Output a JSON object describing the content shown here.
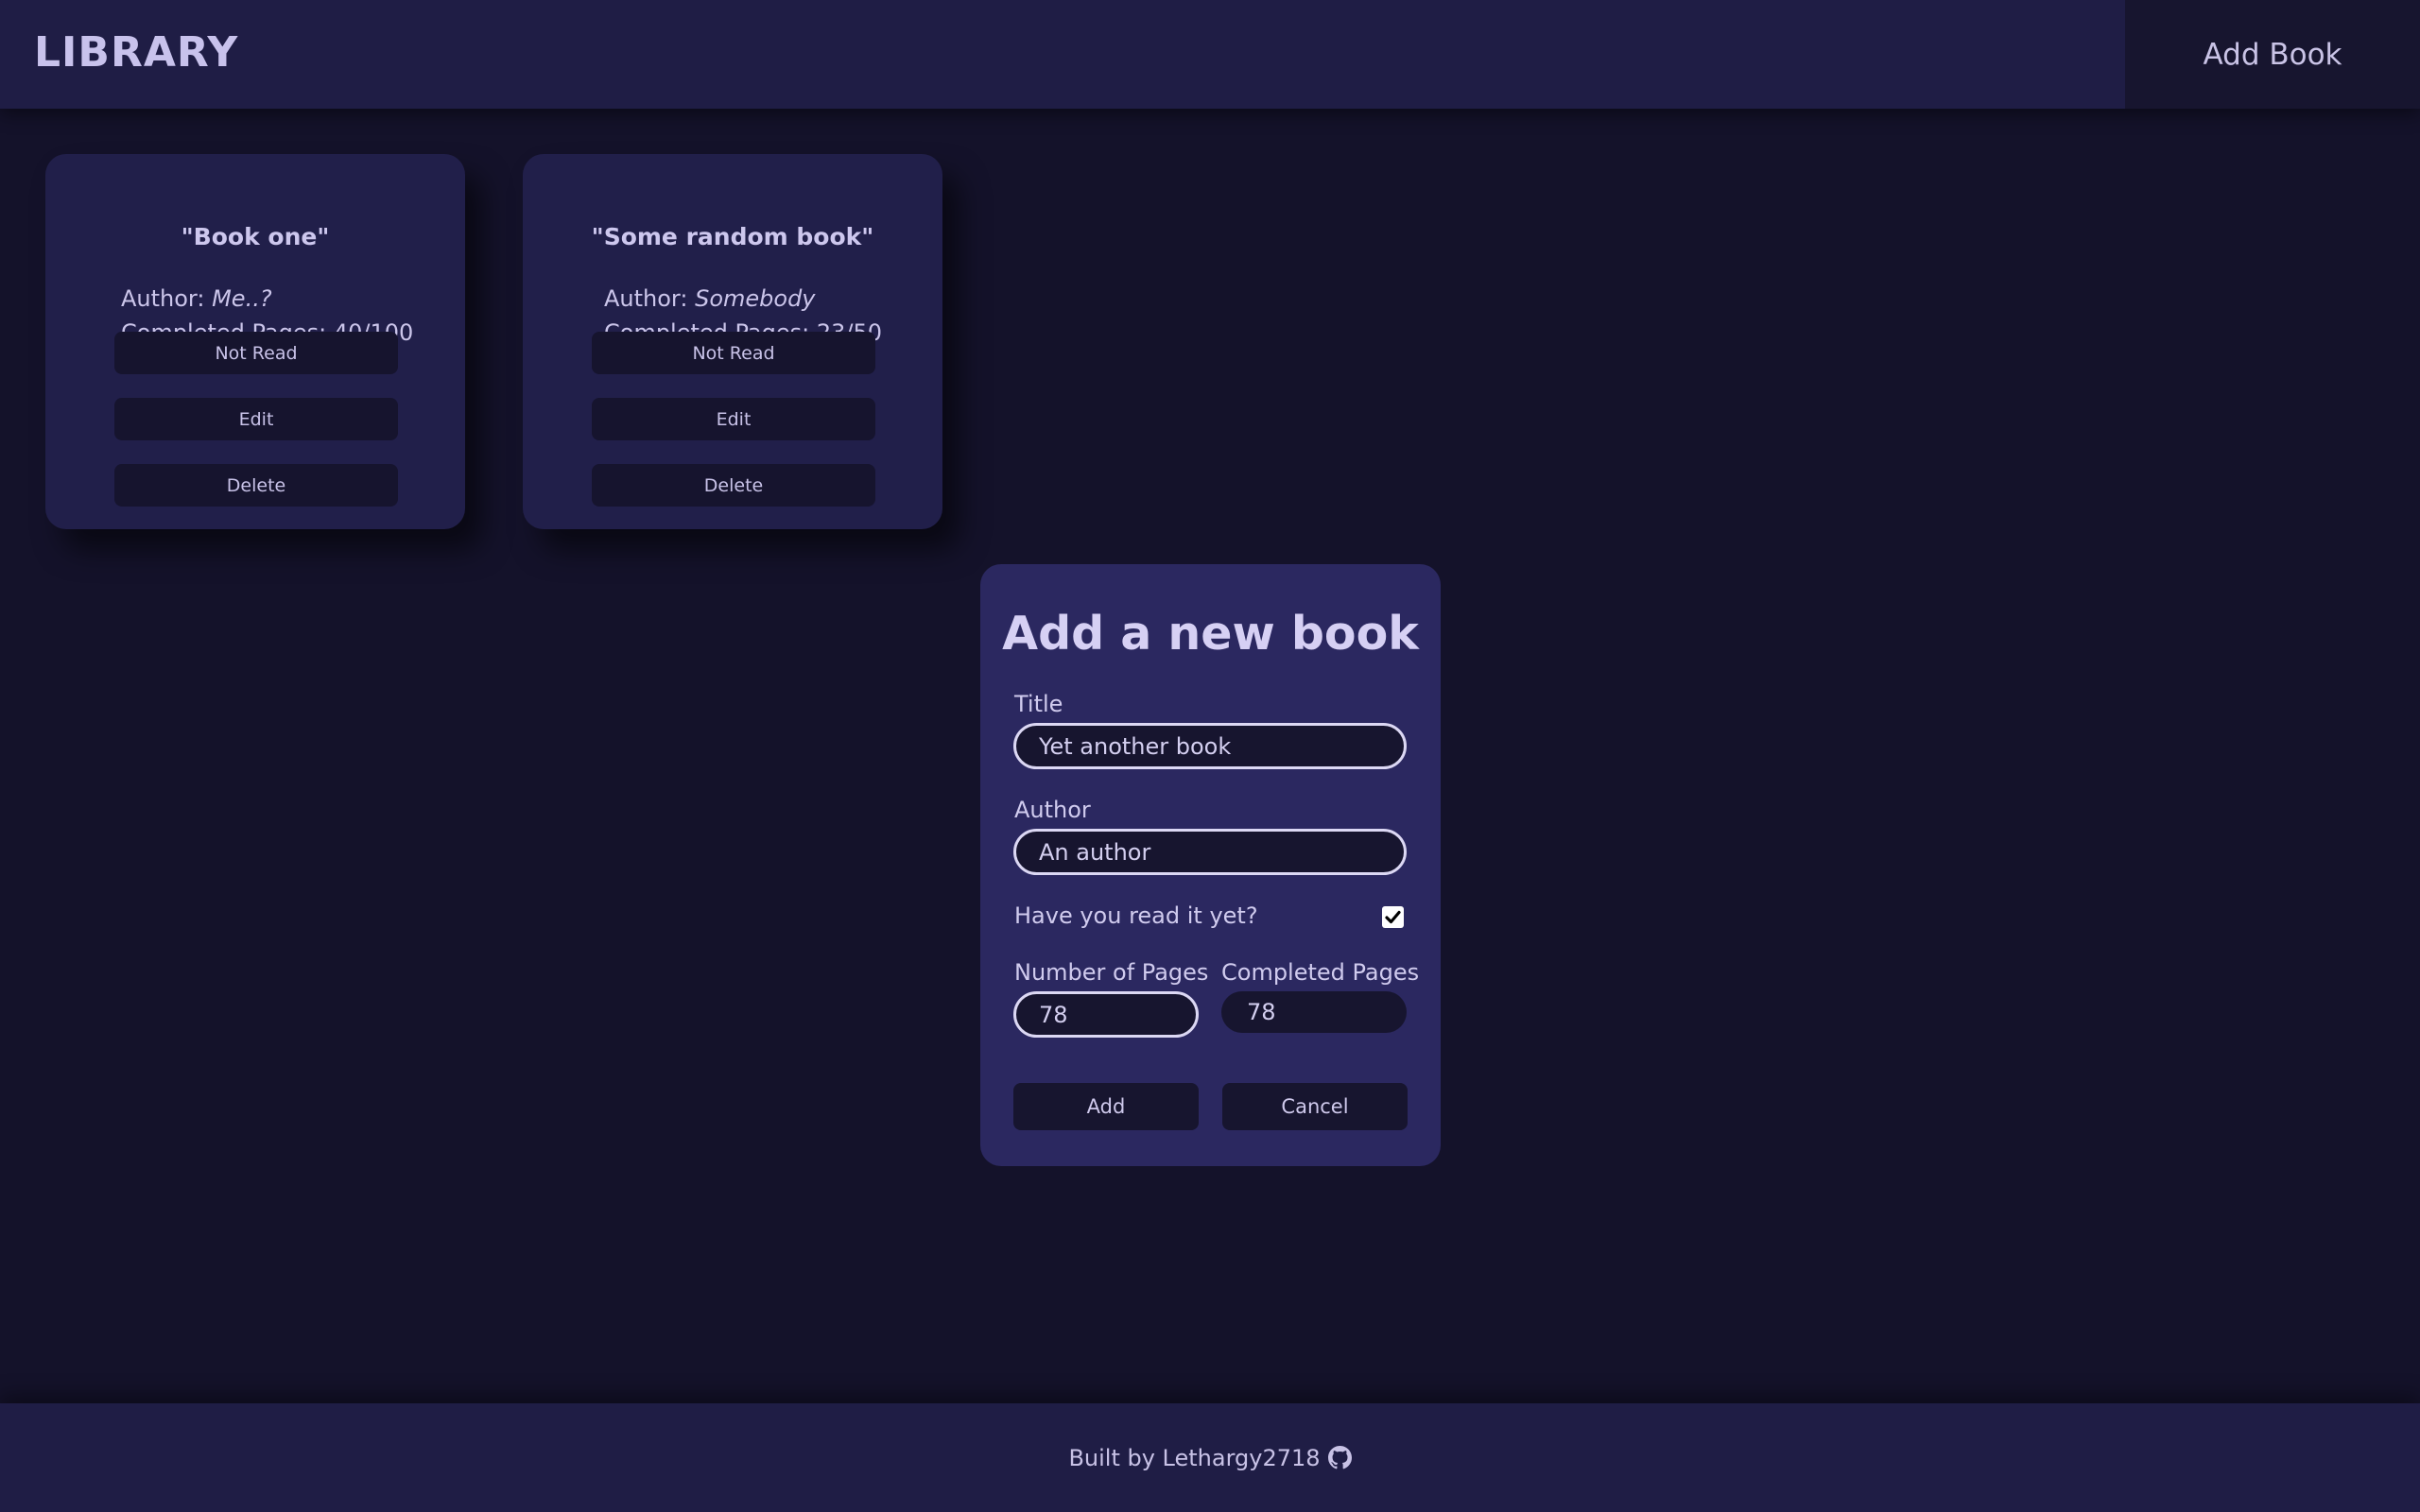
{
  "header": {
    "logo": "LIBRARY",
    "add_book_label": "Add Book"
  },
  "books": [
    {
      "title": "\"Book one\"",
      "author_label": "Author: ",
      "author": "Me..?",
      "pages_label": "Completed Pages: ",
      "pages": "40/100",
      "read_status_label": "Not Read",
      "edit_label": "Edit",
      "delete_label": "Delete"
    },
    {
      "title": "\"Some random book\"",
      "author_label": "Author: ",
      "author": "Somebody",
      "pages_label": "Completed Pages: ",
      "pages": "23/50",
      "read_status_label": "Not Read",
      "edit_label": "Edit",
      "delete_label": "Delete"
    }
  ],
  "modal": {
    "heading": "Add a new book",
    "title_label": "Title",
    "title_value": "Yet another book",
    "author_label": "Author",
    "author_value": "An author",
    "read_question": "Have you read it yet?",
    "read_checked": true,
    "num_pages_label": "Number of Pages",
    "num_pages_value": "78",
    "completed_pages_label": "Completed Pages",
    "completed_pages_value": "78",
    "add_label": "Add",
    "cancel_label": "Cancel"
  },
  "footer": {
    "text": "Built by Lethargy2718",
    "icon": "github-icon"
  }
}
